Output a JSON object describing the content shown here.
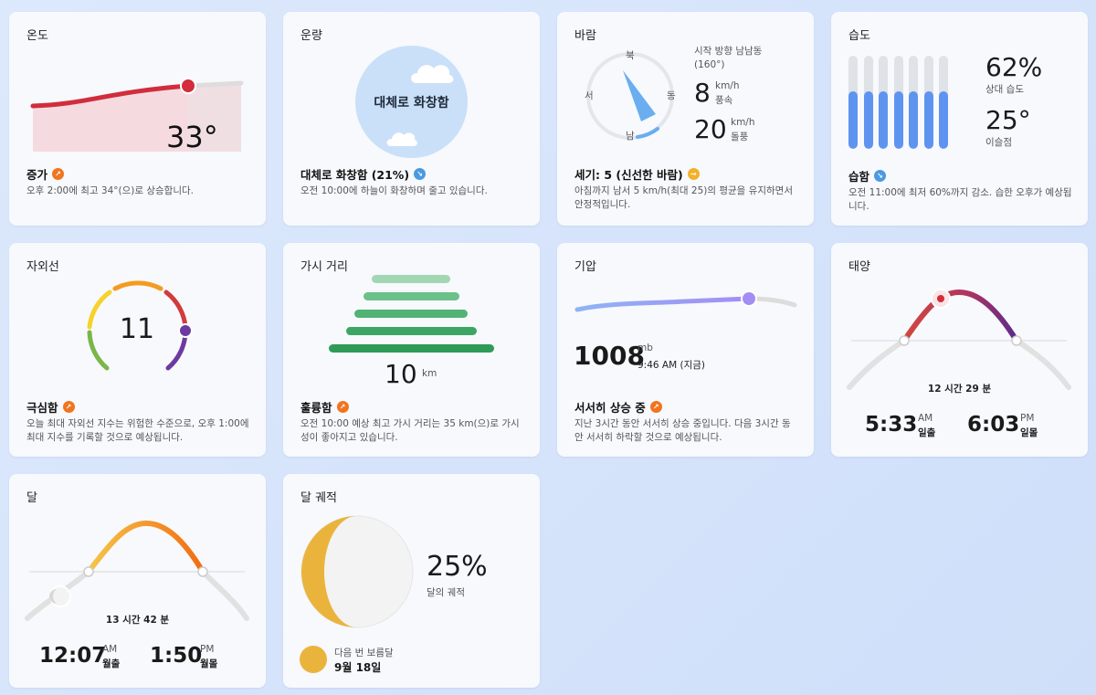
{
  "temp": {
    "title": "온도",
    "value": "33°",
    "status": "증가",
    "desc": "오후 2:00에 최고 34°(으)로 상승합니다."
  },
  "cloud": {
    "title": "운량",
    "center": "대체로 화창함",
    "status": "대체로 화창함 (21%)",
    "desc": "오전 10:00에 하늘이 화창하며 줄고 있습니다."
  },
  "wind": {
    "title": "바람",
    "dir_label": "시작 방향 남남동",
    "dir_deg": "(160°)",
    "n": "북",
    "s": "남",
    "e": "동",
    "w": "서",
    "speed": "8",
    "speed_unit": "km/h",
    "speed_lbl": "풍속",
    "gust": "20",
    "gust_unit": "km/h",
    "gust_lbl": "돌풍",
    "status": "세기: 5 (신선한 바람)",
    "desc": "아침까지 남서 5 km/h(최대 25)의 평균을 유지하면서 안정적입니다."
  },
  "humidity": {
    "title": "습도",
    "value": "62%",
    "value_lbl": "상대 습도",
    "dew": "25°",
    "dew_lbl": "이슬점",
    "status": "습함",
    "desc": "오전 11:00에 최저 60%까지 감소. 습한 오후가 예상됩니다.",
    "bar_levels": [
      0.62,
      0.62,
      0.62,
      0.62,
      0.62,
      0.62,
      0.62
    ]
  },
  "uv": {
    "title": "자외선",
    "value": "11",
    "status": "극심함",
    "desc": "오늘 최대 자외선 지수는 위험한 수준으로, 오후 1:00에 최대 지수를 기록할 것으로 예상됩니다."
  },
  "visibility": {
    "title": "가시 거리",
    "value": "10",
    "unit": "km",
    "status": "훌륭함",
    "desc": "오전 10:00 예상 최고 가시 거리는 35 km(으)로 가시성이 좋아지고 있습니다."
  },
  "pressure": {
    "title": "기압",
    "value": "1008",
    "unit": "mb",
    "time": "9:46 AM (지금)",
    "status": "서서히 상승 중",
    "desc": "지난 3시간 동안 서서히 상승 중입니다. 다음 3시간 동안 서서히 하락할 것으로 예상됩니다."
  },
  "sun": {
    "title": "태양",
    "duration": "12 시간 29 분",
    "rise": "5:33",
    "rise_ampm": "AM",
    "rise_lbl": "일출",
    "set": "6:03",
    "set_ampm": "PM",
    "set_lbl": "일몰"
  },
  "moon": {
    "title": "달",
    "duration": "13 시간 42 분",
    "rise": "12:07",
    "rise_ampm": "AM",
    "rise_lbl": "월출",
    "set": "1:50",
    "set_ampm": "PM",
    "set_lbl": "월몰"
  },
  "phase": {
    "title": "달 궤적",
    "value": "25%",
    "value_lbl": "달의 궤적",
    "next_lbl": "다음 번 보름달",
    "next_date": "9월 18일"
  },
  "colors": {
    "temp_line": "#d12d3c",
    "cloud_disc": "#c9e0f8",
    "wind_needle": "#6aaef0",
    "humid_bar": "#5f93f0",
    "pressure_line": "#a48cf5",
    "vis_green": "#2f9b57",
    "moon_yellow": "#eab43c"
  }
}
